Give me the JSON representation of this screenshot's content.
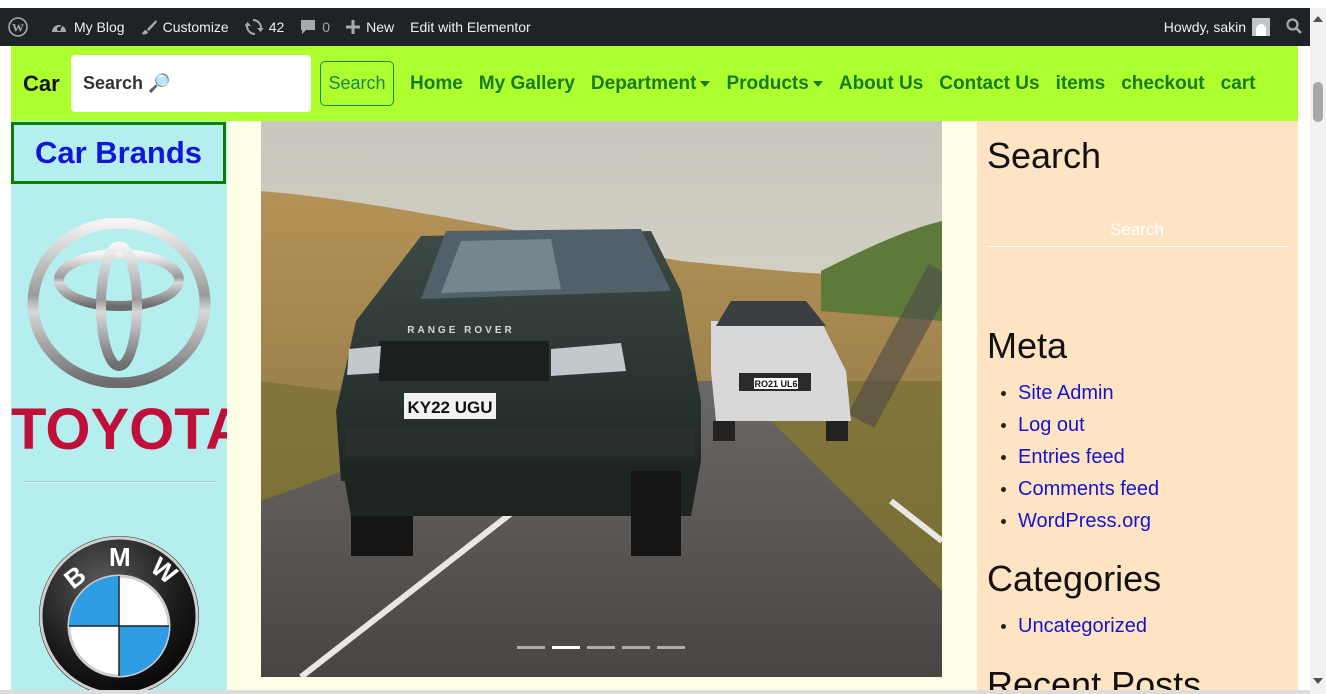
{
  "admin_bar": {
    "wp_logo_icon": "wordpress-logo-icon",
    "site_name": "My Blog",
    "customize": "Customize",
    "updates_count": "42",
    "comments_count": "0",
    "new": "New",
    "elementor": "Edit with Elementor",
    "howdy": "Howdy, sakin"
  },
  "navbar": {
    "brand": "Car",
    "search_placeholder": "Search 🔎",
    "search_button": "Search",
    "links": [
      "Home",
      "My Gallery",
      "Department",
      "Products",
      "About Us",
      "Contact Us",
      "items",
      "checkout",
      "cart"
    ],
    "bg_color": "#adff2f",
    "link_color": "#1a7a1f"
  },
  "left_sidebar": {
    "title": "Car Brands",
    "brand1_word": "TOYOTA",
    "bmw_letters": [
      "B",
      "M",
      "W"
    ],
    "bg_color": "#b4eeee",
    "title_color": "#1515d4"
  },
  "carousel": {
    "slide_count": 5,
    "active_index": 1,
    "plates": [
      "KY22 UGU",
      "RO21 UL6"
    ],
    "badge": "RANGE ROVER"
  },
  "right_sidebar": {
    "search_heading": "Search",
    "search_placeholder": "Search",
    "meta_heading": "Meta",
    "meta_links": [
      "Site Admin",
      "Log out",
      "Entries feed",
      "Comments feed",
      "WordPress.org"
    ],
    "categories_heading": "Categories",
    "categories": [
      "Uncategorized"
    ],
    "recent_posts_heading": "Recent Posts",
    "bg_color": "#ffe4c4"
  }
}
